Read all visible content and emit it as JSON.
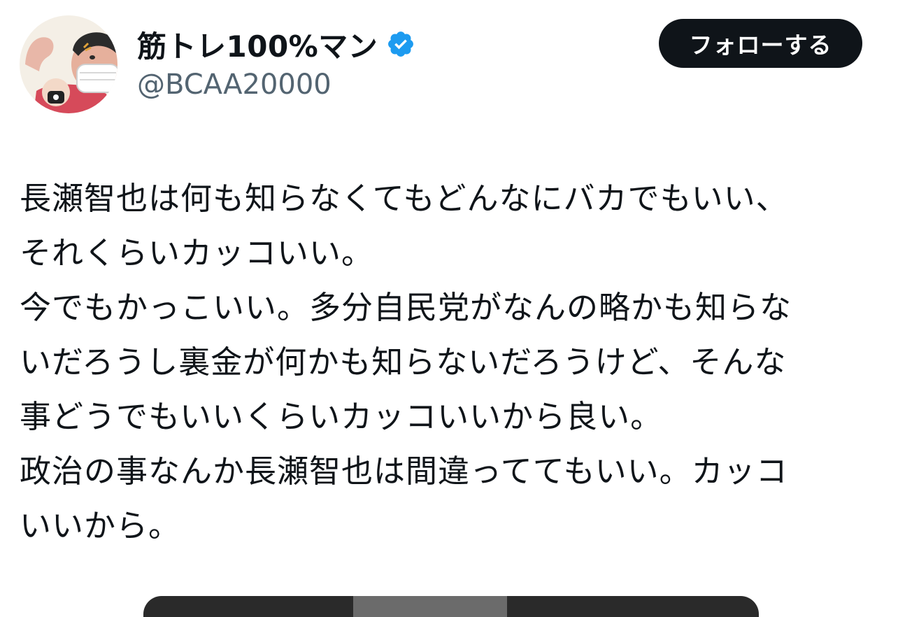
{
  "user": {
    "display_name": "筋トレ100%マン",
    "handle": "@BCAA20000",
    "verified_icon": "verified-badge-icon",
    "avatar_icon": "avatar-image"
  },
  "actions": {
    "follow_label": "フォローする"
  },
  "tweet": {
    "text": "長瀬智也は何も知らなくてもどんなにバカでもいい、\nそれくらいカッコいい。\n今でもかっこいい。多分自民党がなんの略かも知らな\nいだろうし裏金が何かも知らないだろうけど、そんな\n事どうでもいいくらいカッコいいから良い。\n政治の事なんか長瀬智也は間違っててもいい。カッコ\nいいから。"
  },
  "colors": {
    "text_primary": "#0f1419",
    "text_secondary": "#536471",
    "button_bg": "#0f1419",
    "button_text": "#ffffff",
    "verified_blue": "#1d9bf0"
  }
}
